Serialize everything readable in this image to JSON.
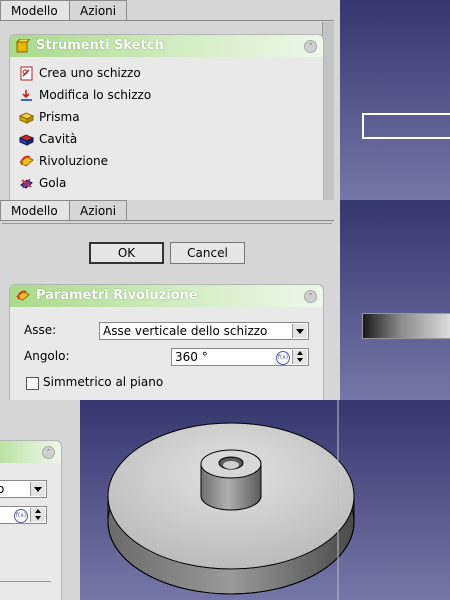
{
  "tabs": {
    "model": "Modello",
    "actions": "Azioni"
  },
  "sketch_tools": {
    "title": "Strumenti Sketch",
    "items": [
      {
        "label": "Crea uno schizzo",
        "icon": "new-sketch-icon"
      },
      {
        "label": "Modifica lo schizzo",
        "icon": "edit-sketch-icon"
      },
      {
        "label": "Prisma",
        "icon": "pad-icon"
      },
      {
        "label": "Cavità",
        "icon": "pocket-icon"
      },
      {
        "label": "Rivoluzione",
        "icon": "revolution-icon"
      },
      {
        "label": "Gola",
        "icon": "groove-icon"
      }
    ]
  },
  "dialog": {
    "ok": "OK",
    "cancel": "Cancel",
    "params_title": "Parametri Rivoluzione",
    "axis_label": "Asse:",
    "axis_value": "Asse verticale dello schizzo",
    "angle_label": "Angolo:",
    "angle_value": "360 °",
    "symmetric_label": "Simmetrico al piano",
    "fx_label": "f(x)"
  },
  "partial": {
    "axis_fragment": "o"
  },
  "colors": {
    "header_green": "#a9da8a",
    "viewport_top": "#36366e",
    "viewport_bottom": "#7676a8"
  }
}
